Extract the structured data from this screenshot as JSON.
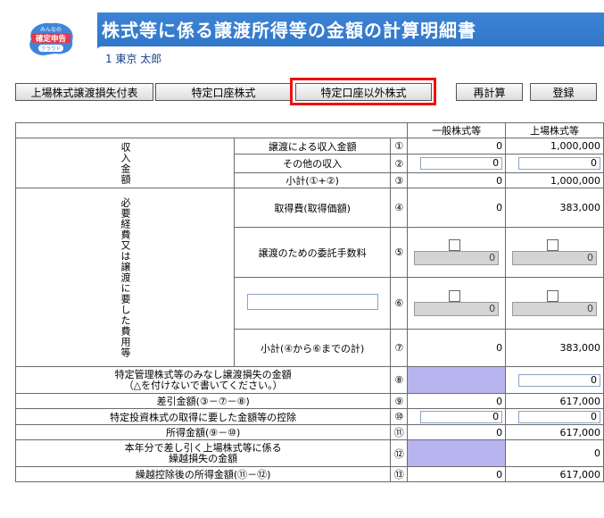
{
  "header": {
    "logo_line1": "みんなの",
    "logo_line2": "確定申告",
    "logo_line3": "クラウド",
    "title": "株式等に係る譲渡所得等の金額の計算明細書",
    "taxpayer": "1 東京 太郎"
  },
  "toolbar": {
    "btn_loss_attach": "上場株式譲渡損失付表",
    "btn_specified": "特定口座株式",
    "btn_non_specified": "特定口座以外株式",
    "btn_recalc": "再計算",
    "btn_register": "登録"
  },
  "table": {
    "col_general": "一般株式等",
    "col_listed": "上場株式等",
    "group_income": "収入金額",
    "group_expense": "必要経費又は譲渡に要した費用等",
    "rows": {
      "r1": {
        "label": "譲渡による収入金額",
        "no": "①",
        "general": "0",
        "listed": "1,000,000"
      },
      "r2": {
        "label": "その他の収入",
        "no": "②",
        "general": "0",
        "listed": "0"
      },
      "r3": {
        "label": "小計(①+②)",
        "no": "③",
        "general": "0",
        "listed": "1,000,000"
      },
      "r4": {
        "label": "取得費(取得価額)",
        "no": "④",
        "general": "0",
        "listed": "383,000"
      },
      "r5": {
        "label": "譲渡のための委託手数料",
        "no": "⑤",
        "general": "0",
        "listed": "0"
      },
      "r6": {
        "label": "",
        "no": "⑥",
        "general": "0",
        "listed": "0"
      },
      "r7": {
        "label": "小計(④から⑥までの計)",
        "no": "⑦",
        "general": "0",
        "listed": "383,000"
      },
      "r8": {
        "label1": "特定管理株式等のみなし譲渡損失の金額",
        "label2": "（△を付けないで書いてください。）",
        "no": "⑧",
        "listed": "0"
      },
      "r9": {
        "label": "差引金額(③－⑦－⑧)",
        "no": "⑨",
        "general": "0",
        "listed": "617,000"
      },
      "r10": {
        "label": "特定投資株式の取得に要した金額等の控除",
        "no": "⑩",
        "general": "0",
        "listed": "0"
      },
      "r11": {
        "label": "所得金額(⑨－⑩)",
        "no": "⑪",
        "general": "0",
        "listed": "617,000"
      },
      "r12": {
        "label1": "本年分で差し引く上場株式等に係る",
        "label2": "繰越損失の金額",
        "no": "⑫",
        "listed": "0"
      },
      "r13": {
        "label": "繰越控除後の所得金額(⑪－⑫)",
        "no": "⑬",
        "general": "0",
        "listed": "617,000"
      }
    }
  },
  "colors": {
    "title_band": "#2f74c8",
    "purple_cell": "#b7b4f0",
    "highlight": "#e11111"
  }
}
